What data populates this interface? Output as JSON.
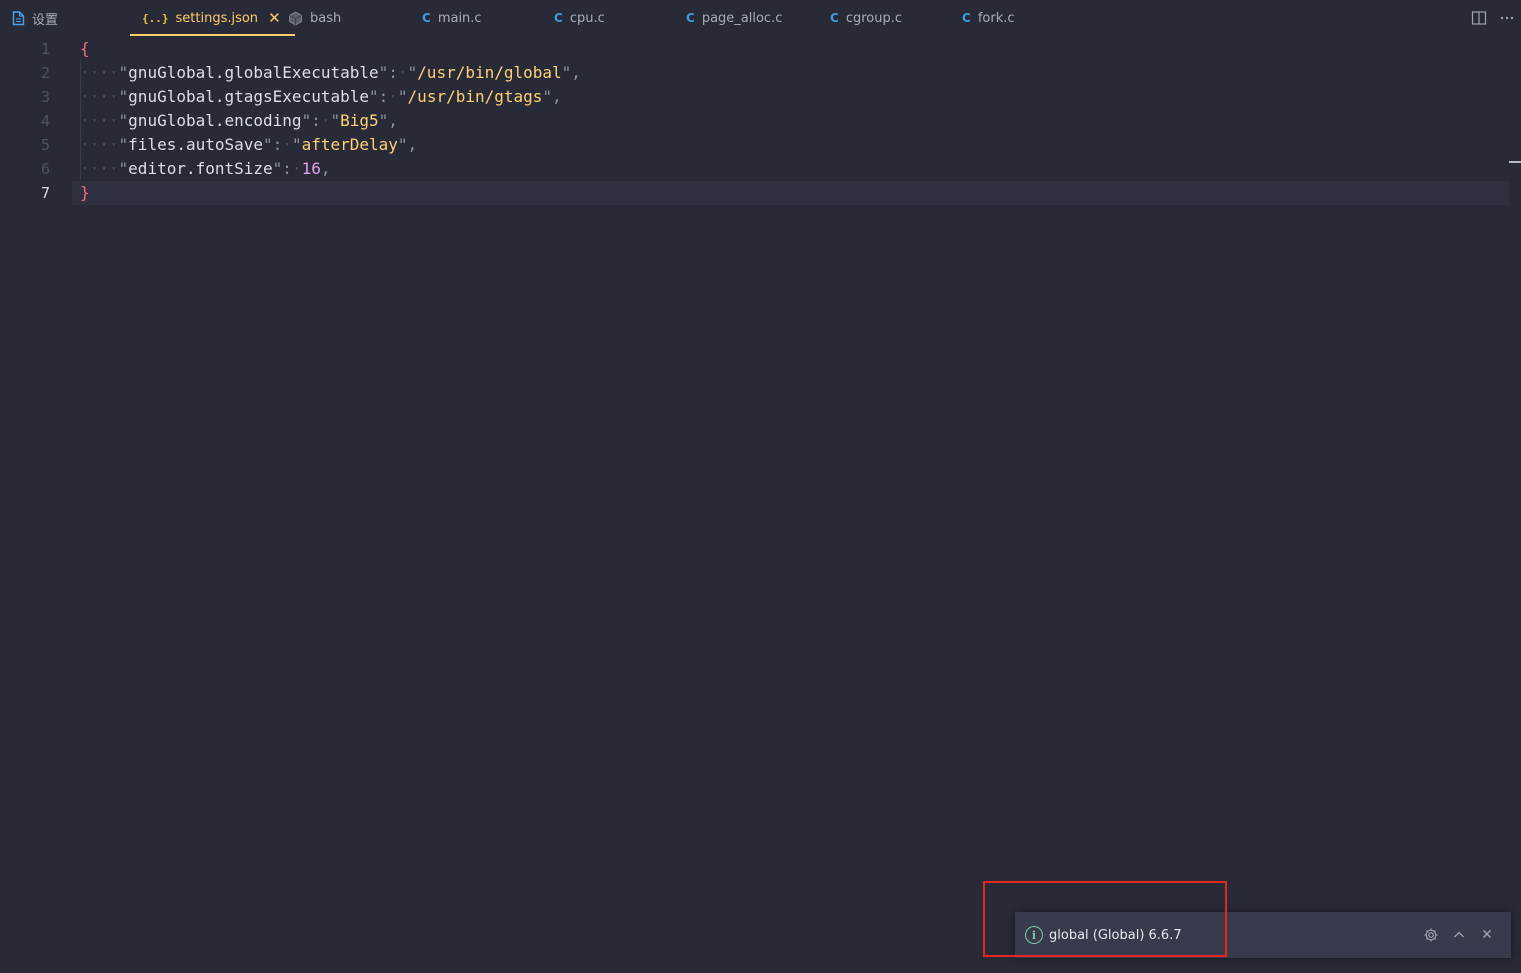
{
  "tabs": [
    {
      "label": "设置",
      "icon": "settings-file-icon"
    },
    {
      "label": "settings.json",
      "icon": "json-icon",
      "icon_glyph": "{..}",
      "active": true
    },
    {
      "label": "bash",
      "icon": "bash-icon"
    },
    {
      "label": "main.c",
      "icon": "c-file-icon",
      "icon_glyph": "C"
    },
    {
      "label": "cpu.c",
      "icon": "c-file-icon",
      "icon_glyph": "C"
    },
    {
      "label": "page_alloc.c",
      "icon": "c-file-icon",
      "icon_glyph": "C"
    },
    {
      "label": "cgroup.c",
      "icon": "c-file-icon",
      "icon_glyph": "C"
    },
    {
      "label": "fork.c",
      "icon": "c-file-icon",
      "icon_glyph": "C"
    }
  ],
  "toolbar": {
    "split_icon": "split-editor-icon",
    "more_icon": "more-actions-icon"
  },
  "editor": {
    "line_numbers": [
      "1",
      "2",
      "3",
      "4",
      "5",
      "6",
      "7"
    ],
    "current_line": "7",
    "lines": [
      {
        "open": "{"
      },
      {
        "key": "gnuGlobal.globalExecutable",
        "value": "/usr/bin/global",
        "type": "string"
      },
      {
        "key": "gnuGlobal.gtagsExecutable",
        "value": "/usr/bin/gtags",
        "type": "string"
      },
      {
        "key": "gnuGlobal.encoding",
        "value": "Big5",
        "type": "string"
      },
      {
        "key": "files.autoSave",
        "value": "afterDelay",
        "type": "string"
      },
      {
        "key": "editor.fontSize",
        "value": "16",
        "type": "number"
      },
      {
        "close": "}"
      }
    ],
    "indent_dots": "····",
    "colon_space": "·"
  },
  "notification": {
    "message": "global (Global) 6.6.7",
    "icon": "info-icon",
    "icon_glyph": "i",
    "actions": [
      "gear-icon",
      "chevron-up-icon",
      "close-icon"
    ],
    "close_glyph": "✕"
  },
  "colors": {
    "accent": "#ffcc66",
    "background": "#282a38",
    "string": "#ffd173",
    "number": "#dfa0e6",
    "bracket": "#f26d78",
    "highlight": "#e5261f"
  }
}
